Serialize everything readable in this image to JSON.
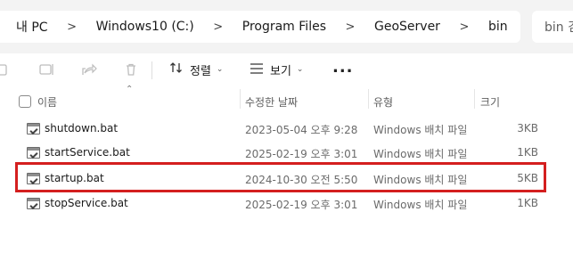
{
  "breadcrumb": {
    "items": [
      "내 PC",
      "Windows10 (C:)",
      "Program Files",
      "GeoServer",
      "bin"
    ],
    "separator": ">"
  },
  "search": {
    "placeholder": "bin 검"
  },
  "toolbar": {
    "icons": [
      "copy-icon",
      "rename-icon",
      "share-icon",
      "delete-icon"
    ],
    "sort_label": "정렬",
    "view_label": "보기",
    "more_label": "..."
  },
  "columns": {
    "name": "이름",
    "date": "수정한 날짜",
    "type": "유형",
    "size": "크기"
  },
  "files": [
    {
      "name": "shutdown.bat",
      "date": "2023-05-04 오후 9:28",
      "type": "Windows 배치 파일",
      "size": "3KB"
    },
    {
      "name": "startService.bat",
      "date": "2025-02-19 오후 3:01",
      "type": "Windows 배치 파일",
      "size": "1KB"
    },
    {
      "name": "startup.bat",
      "date": "2024-10-30 오전 5:50",
      "type": "Windows 배치 파일",
      "size": "5KB"
    },
    {
      "name": "stopService.bat",
      "date": "2025-02-19 오후 3:01",
      "type": "Windows 배치 파일",
      "size": "1KB"
    }
  ],
  "colors": {
    "highlight": "#d41f1f",
    "address_bg": "#f3f3f3"
  }
}
